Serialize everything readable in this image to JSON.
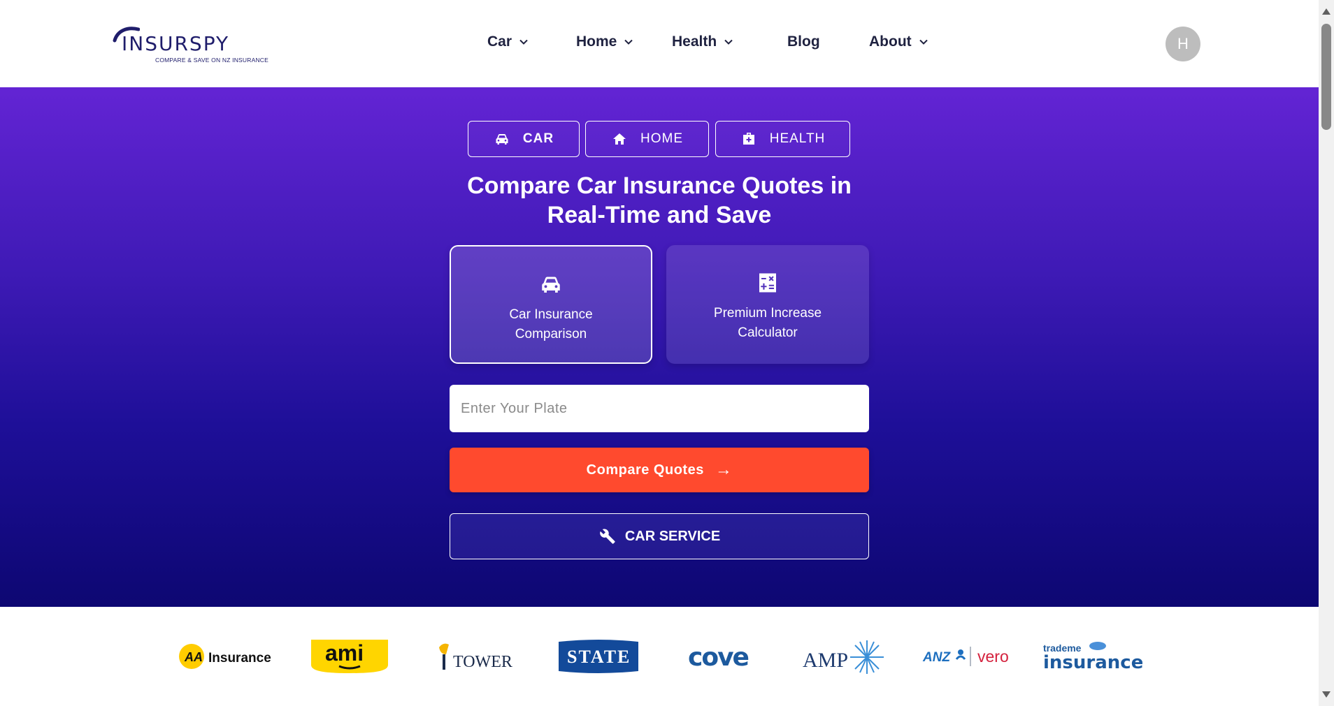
{
  "logo": {
    "word": "INSURSPY",
    "tagline": "COMPARE & SAVE ON NZ INSURANCE"
  },
  "nav": {
    "items": [
      {
        "label": "Car",
        "has_dropdown": true
      },
      {
        "label": "Home",
        "has_dropdown": true
      },
      {
        "label": "Health",
        "has_dropdown": true
      },
      {
        "label": "Blog",
        "has_dropdown": false
      },
      {
        "label": "About",
        "has_dropdown": true
      }
    ]
  },
  "user": {
    "avatar_initial": "H"
  },
  "hero": {
    "tabs": [
      {
        "label": "CAR",
        "icon": "car-icon",
        "active": true
      },
      {
        "label": "HOME",
        "icon": "home-icon",
        "active": false
      },
      {
        "label": "HEALTH",
        "icon": "medical-kit-icon",
        "active": false
      }
    ],
    "title": "Compare Car Insurance Quotes in Real-Time and Save",
    "options": [
      {
        "label": "Car Insurance Comparison",
        "icon": "car-icon",
        "selected": true
      },
      {
        "label": "Premium Increase Calculator",
        "icon": "calculator-icon",
        "selected": false
      }
    ],
    "plate_placeholder": "Enter Your Plate",
    "plate_value": "",
    "compare_label": "Compare Quotes",
    "compare_arrow": "→",
    "service_label": "CAR SERVICE"
  },
  "partners": {
    "logos": [
      {
        "name": "AA Insurance",
        "mark": "AA",
        "word": "Insurance"
      },
      {
        "name": "AMI",
        "mark": "ami"
      },
      {
        "name": "Tower",
        "mark": "TOWER"
      },
      {
        "name": "State",
        "mark": "STATE"
      },
      {
        "name": "Cove",
        "mark": "cove"
      },
      {
        "name": "AMP",
        "mark": "AMP"
      },
      {
        "name": "ANZ Vero",
        "mark_left": "ANZ",
        "mark_right": "vero"
      },
      {
        "name": "Trade Me Insurance",
        "mark_top": "trademe",
        "mark_bottom": "insurance"
      }
    ]
  },
  "colors": {
    "hero_top": "#6324d4",
    "hero_bottom": "#0d0772",
    "cta": "#ff4a2e",
    "nav_text": "#1f2240"
  }
}
